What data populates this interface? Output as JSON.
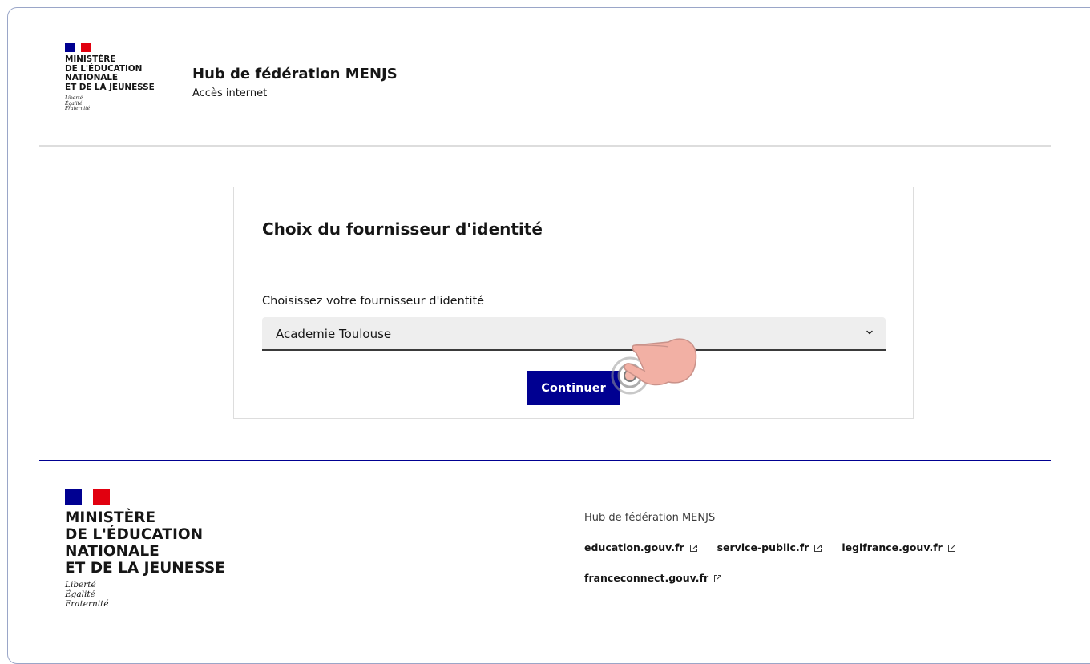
{
  "header": {
    "logo_lines": [
      "MINISTÈRE",
      "DE L'ÉDUCATION",
      "NATIONALE",
      "ET DE LA JEUNESSE"
    ],
    "devise": [
      "Liberté",
      "Égalité",
      "Fraternité"
    ],
    "service_title": "Hub de fédération MENJS",
    "service_tagline": "Accès internet"
  },
  "main": {
    "card_title": "Choix du fournisseur d'identité",
    "select_label": "Choisissez votre fournisseur d'identité",
    "select_value": "Academie Toulouse",
    "continue_label": "Continuer"
  },
  "footer": {
    "logo_lines": [
      "MINISTÈRE",
      "DE L'ÉDUCATION",
      "NATIONALE",
      "ET DE LA JEUNESSE"
    ],
    "devise": [
      "Liberté",
      "Égalité",
      "Fraternité"
    ],
    "description": "Hub de fédération MENJS",
    "links": [
      "education.gouv.fr",
      "service-public.fr",
      "legifrance.gouv.fr",
      "franceconnect.gouv.fr"
    ]
  },
  "icons": {
    "select_chevron": "chevron-down-icon",
    "external_link": "external-link-icon",
    "pointer": "tap-hand-icon"
  },
  "colors": {
    "primary_blue": "#000091",
    "marianne_red": "#e1000f",
    "select_bg": "#eeeeee",
    "hand_fill": "#f2b0a4"
  }
}
